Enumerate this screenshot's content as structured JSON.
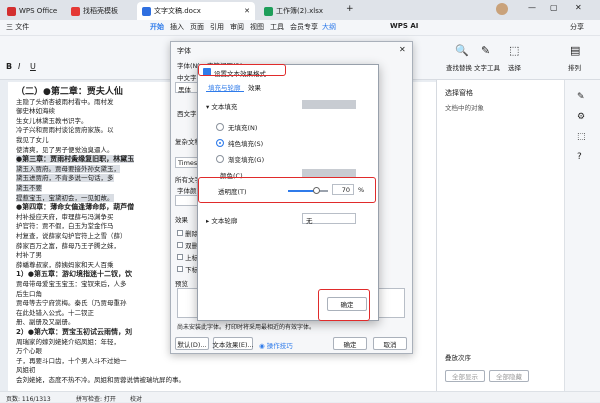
{
  "tabs": {
    "wps": "WPS Office",
    "template": "找稻壳模板",
    "doc": "文字文稿.docx",
    "sheet": "工作簿(2).xlsx"
  },
  "menu": {
    "file": "三 文件",
    "items": [
      "开始",
      "插入",
      "页面",
      "引用",
      "审阅",
      "视图",
      "工具",
      "会员专享",
      "大纲"
    ],
    "wps_ai": "WPS AI",
    "share": "分享"
  },
  "ribbon": {
    "find_replace": "查找替换",
    "select": "选择",
    "layout": "排列",
    "text_tool": "文字工具"
  },
  "document": {
    "lines": [
      "（二）●第二章：贾夫人仙",
      "主隐了头娇杏被雨村看中。雨村发",
      "御史林如海续",
      "生女儿林黛玉教书识字。",
      "冷子兴和贾雨村谈论贾府家族。以",
      "我见了女儿",
      "使清爽，见了男子便觉浊臭逼人。",
      "●第三章：贾雨村夤缘复旧职，林黛玉",
      "黛玉入贾府。贾母要接外孙女黛玉，",
      "黛玉进贾府，不肯多说一句话，多",
      "黛玉不要",
      "提惹宝玉，宝黛初会，一见如故。",
      "●第四章：薄命女偏逢薄命郎，葫芦僧",
      "村补授应天府，审理薛与冯渊争买",
      "护官符：贾不假，白玉为堂金作马",
      "村复查，说薛家勾护官符上之雪（薛）",
      "薛家百万之富，薛母乃王子腾之妹，",
      "村补了男",
      "薛蟠尊叔家，薛姨妈家和天人百乘",
      "1）●第五章：游幻境指迷十二钗，饮",
      "贾母带母爱宝玉宝玉：宝钗来后，人多",
      "后生口角",
      "贾母等去宁府赏梅。秦氏（乃贾母重孙",
      "在此处错入公式。十二钗正",
      "册、副册及又副册。",
      "2）●第六章：贾宝玉初试云雨情，刘",
      "周瑞家的嫁刘姥姥介绍凤姐：年轻，",
      "万个心眼",
      "子，再要斗口齿，十个男人斗不过她一",
      "风姐初",
      "会刘姥姥，态度不热不冷。凤姐和贾蓉说情被瑞坑屏的事。"
    ]
  },
  "font_dialog": {
    "title": "字体",
    "tab_font": "字体(N)",
    "tab_spacing": "字符间距(R)",
    "chinese_font_label": "中文字",
    "chinese_font_value": "黑体",
    "western_label": "西文字",
    "western_value": "Times",
    "complex_label": "复杂文种",
    "complex_value": "Times",
    "all_text_label": "所有文字",
    "font_color_label": "字体颜",
    "effects_label": "效果",
    "effect_items": [
      "删除",
      "双删",
      "上标",
      "下标"
    ],
    "preview_label": "预览",
    "note": "尚未安装此字体。打印时将采用最相近的有效字体。",
    "default_button": "默认(D)...",
    "text_effects_button": "文本效果(E)...",
    "tips": "操作技巧",
    "ok": "确定",
    "cancel": "取消"
  },
  "effects_dialog": {
    "title": "设置文本效果格式",
    "tab_fill": "填充与轮廓",
    "tab_effects": "效果",
    "section_fill": "文本填充",
    "no_fill": "无填充(N)",
    "solid_fill": "纯色填充(S)",
    "gradient_fill": "渐变填充(G)",
    "color_label": "颜色(C)",
    "transparency_label": "透明度(T)",
    "transparency_value": "70",
    "transparency_unit": "%",
    "transparency_percent": 70,
    "section_outline": "文本轮廓",
    "outline_value": "无",
    "ok": "确定"
  },
  "right_panel": {
    "title": "选择窗格",
    "subtitle": "文档中的对象",
    "order_label": "叠放次序",
    "show_all": "全部显示",
    "hide_all": "全部隐藏"
  },
  "status": {
    "page": "页数: 116/1313",
    "spell": "拼写检查: 打开",
    "proof": "校对"
  },
  "colors": {
    "accent": "#2f7bea",
    "highlight_red": "#e02b2b"
  }
}
